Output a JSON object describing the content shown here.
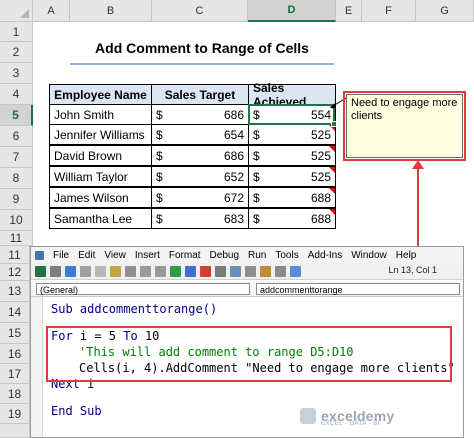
{
  "columns": [
    "A",
    "B",
    "C",
    "D",
    "E",
    "F",
    "G"
  ],
  "selected_column": "D",
  "rows": [
    "1",
    "2",
    "3",
    "4",
    "5",
    "6",
    "7",
    "8",
    "9",
    "10",
    "11",
    "12",
    "13",
    "14",
    "15",
    "16",
    "17",
    "18",
    "19"
  ],
  "selected_row": "5",
  "title": "Add Comment to Range of Cells",
  "table": {
    "headers": [
      "Employee Name",
      "Sales Target",
      "Sales Achieved"
    ],
    "rows": [
      {
        "name": "John Smith",
        "target": "686",
        "achieved": "554"
      },
      {
        "name": "Jennifer Williams",
        "target": "654",
        "achieved": "525"
      },
      {
        "name": "David Brown",
        "target": "686",
        "achieved": "525"
      },
      {
        "name": "William Taylor",
        "target": "652",
        "achieved": "525"
      },
      {
        "name": "James Wilson",
        "target": "672",
        "achieved": "688"
      },
      {
        "name": "Samantha Lee",
        "target": "683",
        "achieved": "688"
      }
    ],
    "currency": "$"
  },
  "comment": {
    "text": "Need to engage more clients"
  },
  "vbe": {
    "menus": [
      "File",
      "Edit",
      "View",
      "Insert",
      "Format",
      "Debug",
      "Run",
      "Tools",
      "Add-Ins",
      "Window",
      "Help"
    ],
    "status": "Ln 13, Col 1",
    "object_dropdown": "(General)",
    "proc_dropdown": "addcommenttorange",
    "code": {
      "sub_open": "Sub addcommenttorange()",
      "for_line": {
        "kw1": "For",
        "mid": " i = 5 ",
        "kw2": "To",
        "end": " 10"
      },
      "comment_line": "'This will add comment to range D5:D10",
      "cells_line": "Cells(i, 4).AddComment \"Need to engage more clients\"",
      "next_line": {
        "kw": "Next",
        "rest": " i"
      },
      "end_line": {
        "kw": "End Sub"
      }
    }
  },
  "watermark": {
    "name": "exceldemy",
    "sub": "EXCEL · DATA · BI"
  },
  "colors": {
    "accent": "#217346",
    "highlight": "#e03a3a",
    "header_fill": "#dce6f2",
    "comment_fill": "#ffffe1"
  }
}
